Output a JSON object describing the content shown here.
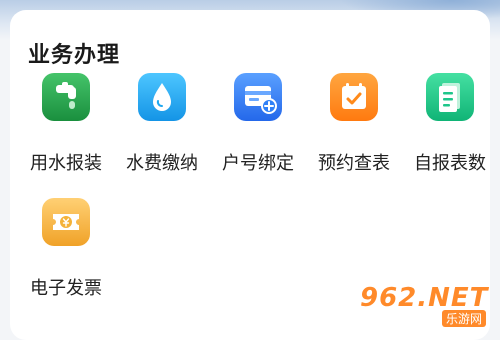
{
  "section": {
    "title": "业务办理"
  },
  "items": [
    {
      "label": "用水报装",
      "icon": "water-tap-icon",
      "color": "#20a04a"
    },
    {
      "label": "水费缴纳",
      "icon": "water-drop-icon",
      "color": "#1fa8f0"
    },
    {
      "label": "户号绑定",
      "icon": "card-add-icon",
      "color": "#2f80f7"
    },
    {
      "label": "预约查表",
      "icon": "calendar-check-icon",
      "color": "#ff8a1a"
    },
    {
      "label": "自报表数",
      "icon": "document-icon",
      "color": "#1ec68a"
    },
    {
      "label": "电子发票",
      "icon": "ticket-yuan-icon",
      "color": "#f4b23a"
    }
  ],
  "watermark": {
    "brand": "962.NET",
    "text": "乐游网"
  }
}
